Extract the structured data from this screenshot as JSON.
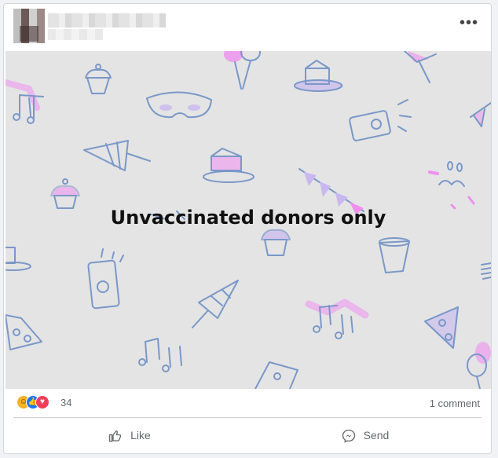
{
  "post": {
    "more_label": "•••",
    "image_text": "Unvaccinated donors only",
    "reaction_count": "34",
    "comment_count": "1 comment"
  },
  "actions": {
    "like_label": "Like",
    "send_label": "Send"
  },
  "icons": {
    "more": "more-options-icon",
    "like": "thumbs-up-icon",
    "send": "messenger-icon",
    "reactions": [
      "haha-reaction-icon",
      "like-reaction-icon",
      "love-reaction-icon"
    ]
  },
  "colors": {
    "doodle_blue": "#7a98c8",
    "doodle_pink": "#ef8ff0",
    "doodle_purple": "#a98ae6",
    "background": "#e4e4e4"
  }
}
